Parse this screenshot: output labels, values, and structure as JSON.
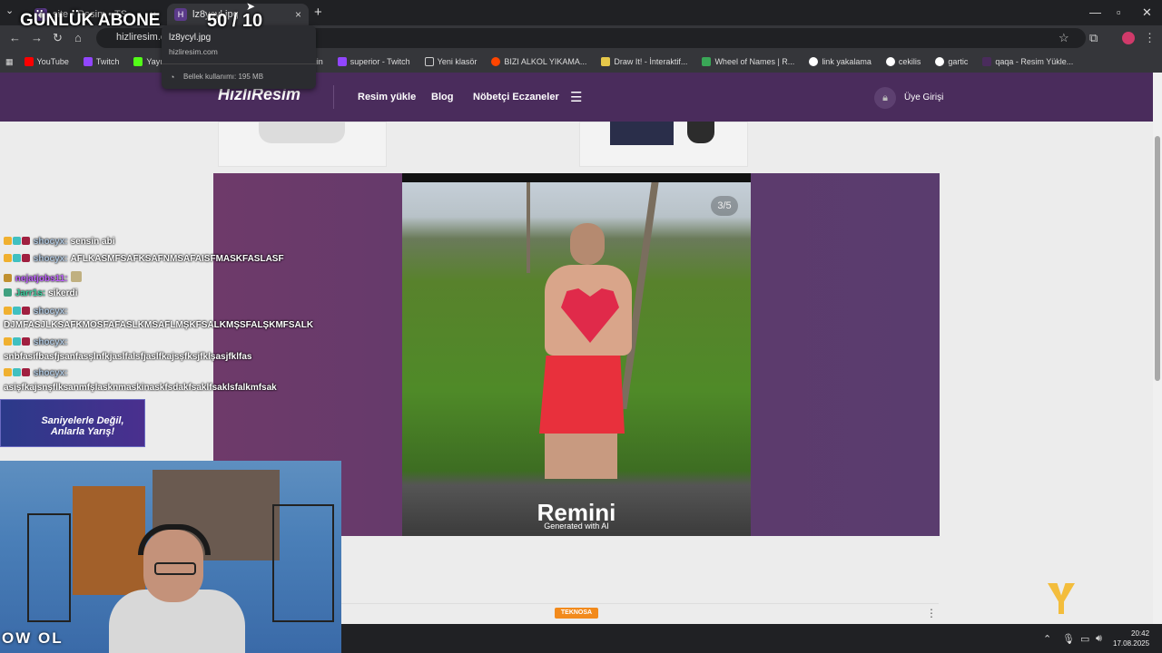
{
  "browser": {
    "tabs": [
      {
        "label": "site • Resim • TS",
        "active": false
      },
      {
        "label": "lz8ycyl.jpg",
        "active": true
      }
    ],
    "url": "hizliresim.com",
    "bookmarks": [
      {
        "label": "YouTube",
        "color": "#ff0000"
      },
      {
        "label": "Twitch",
        "color": "#9146ff"
      },
      {
        "label": "Yayın",
        "color": "#53fc18"
      },
      {
        "label": "Login",
        "color": "#9146ff"
      },
      {
        "label": "superior - Twitch",
        "color": "#9146ff"
      },
      {
        "label": "Yeni klasör",
        "color": "#cccccc"
      },
      {
        "label": "BIZI ALKOL YIKAMA...",
        "color": "#ff4500"
      },
      {
        "label": "Draw It! - İnteraktif...",
        "color": "#e6c84a"
      },
      {
        "label": "Wheel of Names | R...",
        "color": "#3aa757"
      },
      {
        "label": "link yakalama",
        "color": "#ffffff"
      },
      {
        "label": "cekilis",
        "color": "#ffffff"
      },
      {
        "label": "gartic",
        "color": "#ffffff"
      },
      {
        "label": "qaqa - Resim Yükle...",
        "color": "#4a2c5c"
      }
    ],
    "tooltip": {
      "title": "lz8ycyl.jpg",
      "domain": "hizliresim.com",
      "memory": "Bellek kullanımı: 195 MB"
    }
  },
  "site": {
    "logo": "HızlıResim",
    "nav": [
      "Resim yükle",
      "Blog",
      "Nöbetçi Eczaneler"
    ],
    "login": "Üye Girişi",
    "gallery": {
      "counter": "3/5",
      "watermark": "Remini",
      "watermark_sub": "Generated with AI"
    },
    "footer_brand": "TEKNOSA"
  },
  "overlay": {
    "abone_label": "GÜNLÜK ABONE",
    "abone_count": "50 / 10",
    "chat": [
      {
        "user": "shocyx:",
        "user_color": "#b0c8e0",
        "message": "sensin abi"
      },
      {
        "user": "shocyx:",
        "user_color": "#b0c8e0",
        "message": "AFLKASMFSAFKSAFNMSAFAISFMASKFASLASF"
      },
      {
        "user": "nejatjobs11:",
        "user_color": "#c060ff",
        "message": ""
      },
      {
        "user": "Jarr1s:",
        "user_color": "#3ad0a0",
        "message": "sikerdi"
      },
      {
        "user": "shocyx:",
        "user_color": "#b0c8e0",
        "message": "DJMFASJLKSAFKMOSFAFASLKMSAFLMŞKFSALKMŞSFALŞKMFSALK"
      },
      {
        "user": "shocyx:",
        "user_color": "#b0c8e0",
        "message": "snbfasifbasfjsanfasşlnfkjaslfalsfjaslfkajsşfksjfklşasjfklfas"
      },
      {
        "user": "shocyx:",
        "user_color": "#b0c8e0",
        "message": "asişfkajsnşflksanmfşlasknmaskinaskfsdakfsaklfsaklsfalkmfsak"
      }
    ],
    "ad_text": "Saniyelerle Değil, Anlarla Yarış!",
    "brand_overlay": "OW OL"
  },
  "system": {
    "time": "20:42",
    "date": "17.08.2025"
  }
}
